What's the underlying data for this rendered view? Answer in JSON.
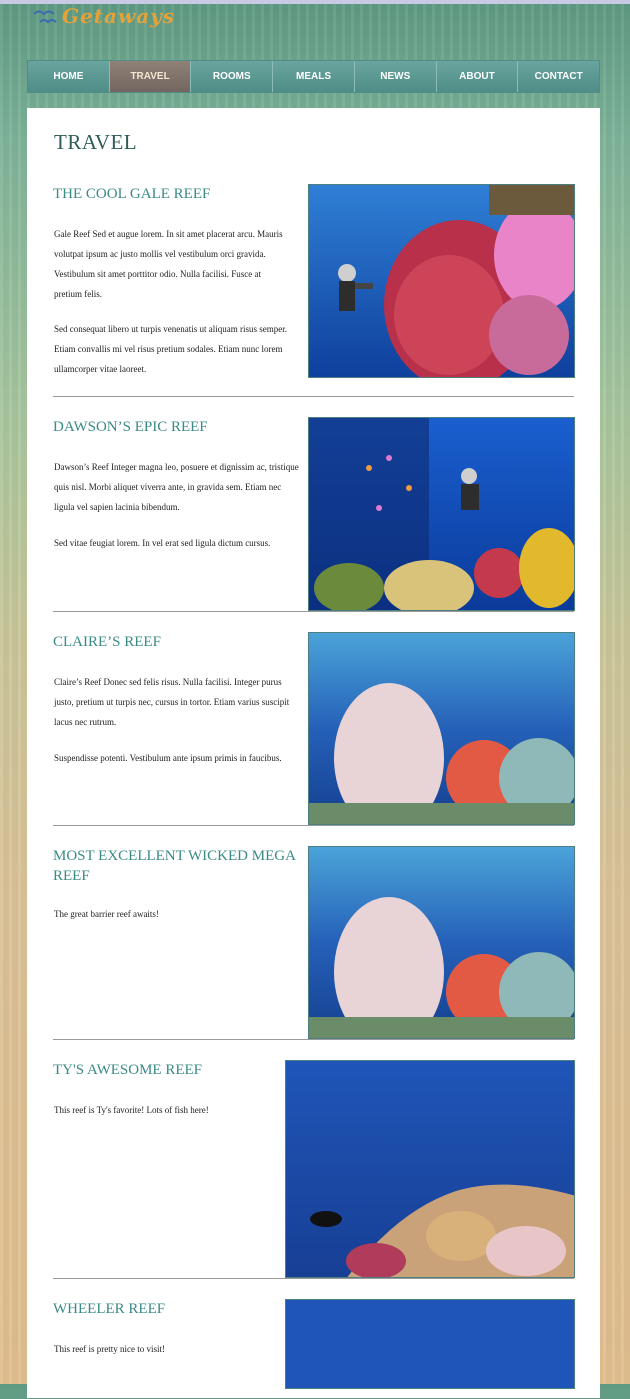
{
  "site": {
    "logo_text": "Getaways"
  },
  "nav": {
    "items": [
      "HOME",
      "TRAVEL",
      "ROOMS",
      "MEALS",
      "NEWS",
      "ABOUT",
      "CONTACT"
    ],
    "active_index": 1
  },
  "page": {
    "title": "TRAVEL"
  },
  "sections": [
    {
      "title": "THE COOL GALE REEF",
      "paragraphs": [
        "Gale Reef Sed et augue lorem. In sit amet placerat arcu. Mauris volutpat ipsum ac justo mollis vel vestibulum orci gravida. Vestibulum sit amet porttitor odio. Nulla facilisi. Fusce at pretium felis.",
        "Sed consequat libero ut turpis venenatis ut aliquam risus semper. Etiam convallis mi vel risus pretium sodales. Etiam nunc lorem ullamcorper vitae laoreet."
      ]
    },
    {
      "title": "DAWSON’S EPIC REEF",
      "paragraphs": [
        "Dawson’s Reef Integer magna leo, posuere et dignissim ac, tristique quis nisl. Morbi aliquet viverra ante, in gravida sem. Etiam nec ligula vel sapien lacinia bibendum.",
        "Sed vitae feugiat lorem. In vel erat sed ligula dictum cursus."
      ]
    },
    {
      "title": "CLAIRE’S REEF",
      "paragraphs": [
        "Claire’s Reef Donec sed felis risus. Nulla facilisi. Integer purus justo, pretium ut turpis nec, cursus in tortor. Etiam varius suscipit lacus nec rutrum.",
        "Suspendisse potenti. Vestibulum ante ipsum primis in faucibus."
      ]
    },
    {
      "title": "MOST EXCELLENT WICKED MEGA REEF",
      "paragraphs": [
        "The great barrier reef awaits!"
      ]
    },
    {
      "title": "TY'S AWESOME REEF",
      "paragraphs": [
        "This reef is Ty's favorite! Lots of fish here!"
      ]
    },
    {
      "title": "WHEELER REEF",
      "paragraphs": [
        "This reef is pretty nice to visit!"
      ]
    }
  ],
  "colors": {
    "accent": "#3a8a86",
    "nav": "#4f8d86",
    "nav_active": "#7f726b"
  },
  "icons": {
    "logo": "seagull-icon"
  }
}
